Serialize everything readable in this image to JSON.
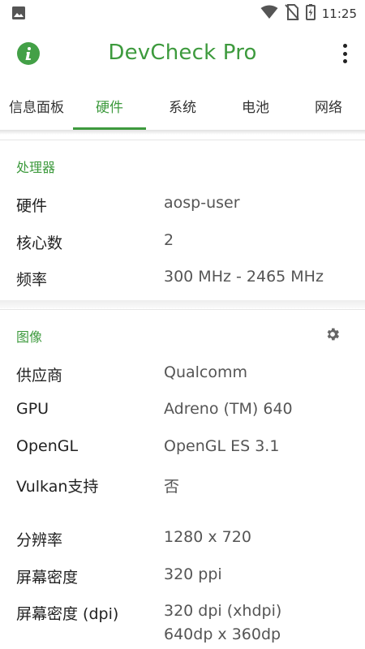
{
  "status_bar": {
    "time": "11:25",
    "icons": [
      "image-icon",
      "wifi-icon",
      "no-sim-icon",
      "battery-charging-icon"
    ]
  },
  "app_bar": {
    "title": "DevCheck Pro",
    "left_icon": "info-icon",
    "right_icon": "more-vert-icon"
  },
  "tabs": [
    {
      "label": "信息面板",
      "active": false
    },
    {
      "label": "硬件",
      "active": true
    },
    {
      "label": "系统",
      "active": false
    },
    {
      "label": "电池",
      "active": false
    },
    {
      "label": "网络",
      "active": false
    }
  ],
  "processor": {
    "title": "处理器",
    "rows": [
      {
        "key": "硬件",
        "value": "aosp-user"
      },
      {
        "key": "核心数",
        "value": "2"
      },
      {
        "key": "频率",
        "value": "300 MHz - 2465 MHz"
      }
    ]
  },
  "graphics": {
    "title": "图像",
    "settings_icon": "gear-icon",
    "rows": [
      {
        "key": "供应商",
        "value": "Qualcomm"
      },
      {
        "key": "GPU",
        "value": "Adreno (TM) 640"
      },
      {
        "key": "OpenGL",
        "value": "OpenGL ES 3.1"
      },
      {
        "key": "Vulkan支持",
        "value": "否"
      },
      {
        "key": "分辨率",
        "value": "1280 x 720"
      },
      {
        "key": "屏幕密度",
        "value": "320 ppi"
      },
      {
        "key": "屏幕密度 (dpi)",
        "value": "320 dpi (xhdpi)",
        "value2": "640dp x 360dp"
      }
    ]
  },
  "colors": {
    "accent": "#3d9a3d",
    "text_primary": "#222222",
    "text_secondary": "#555555"
  }
}
